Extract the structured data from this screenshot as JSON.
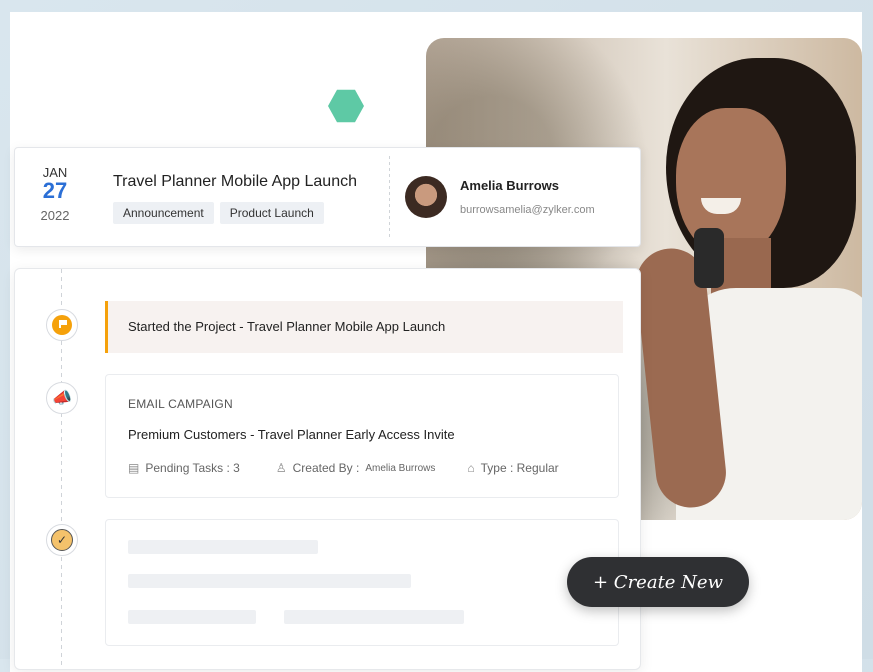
{
  "event": {
    "month": "JAN",
    "day": "27",
    "year": "2022",
    "title": "Travel Planner Mobile App Launch",
    "tags": [
      "Announcement",
      "Product Launch"
    ],
    "contact_name": "Amelia Burrows",
    "contact_email": "burrowsamelia@zylker.com"
  },
  "timeline": {
    "started_text": "Started the Project - Travel Planner Mobile App Launch",
    "campaign": {
      "label": "EMAIL CAMPAIGN",
      "title": "Premium Customers - Travel Planner Early Access Invite",
      "pending_tasks": "Pending Tasks : 3",
      "created_by_label": "Created By :",
      "created_by_value": "Amelia Burrows",
      "type": "Type : Regular"
    }
  },
  "create_button": {
    "label": "+ Create New"
  },
  "colors": {
    "accent_blue": "#2b6fd6",
    "accent_orange": "#f5a10b",
    "hexagon_green": "#5ec9a5",
    "button_dark": "#2f3033"
  },
  "icons": [
    "flag-icon",
    "megaphone-icon",
    "check-circle-icon",
    "document-icon",
    "user-icon",
    "tag-icon"
  ]
}
